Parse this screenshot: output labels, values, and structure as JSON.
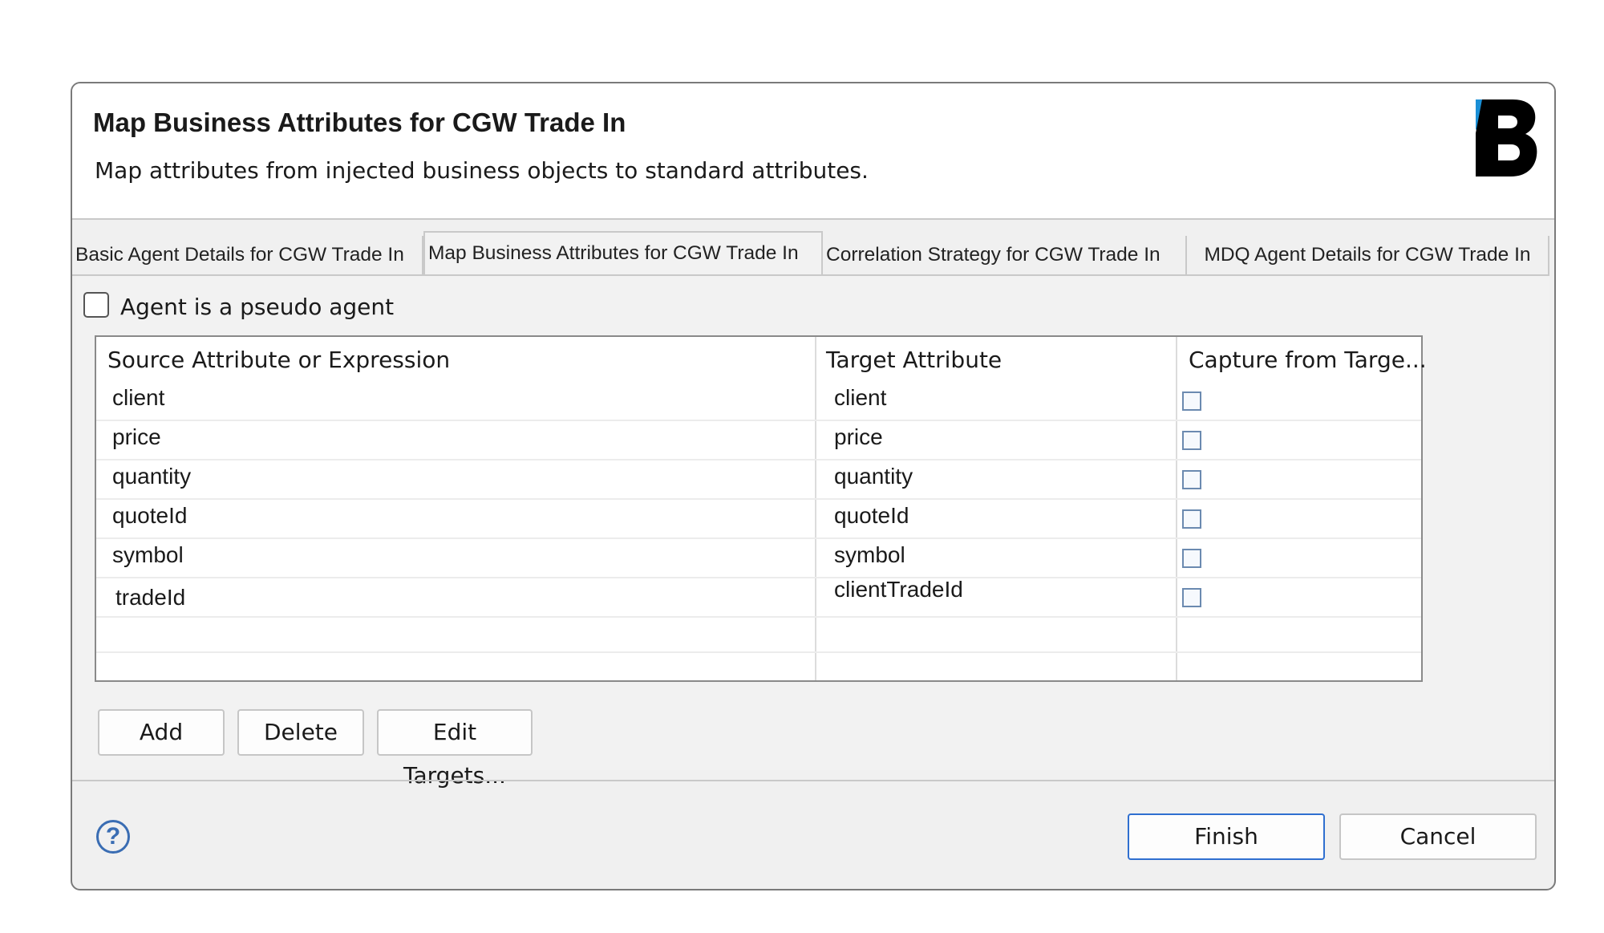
{
  "dialog": {
    "title": "Map Business Attributes for CGW Trade In",
    "subtitle": "Map attributes from injected business objects to standard attributes.",
    "logo_icon": "brand-b-logo"
  },
  "tabs": [
    {
      "label": "Basic Agent Details for CGW Trade In",
      "active": false
    },
    {
      "label": "Map Business Attributes for CGW Trade In",
      "active": true
    },
    {
      "label": "Correlation Strategy for CGW Trade In",
      "active": false
    },
    {
      "label": "MDQ Agent Details for CGW Trade In",
      "active": false
    }
  ],
  "pseudo_agent": {
    "label": "Agent is a pseudo agent",
    "checked": false
  },
  "table": {
    "headers": [
      "Source Attribute or Expression",
      "Target Attribute",
      "Capture from Targe..."
    ],
    "rows": [
      {
        "source": "client",
        "target": "client",
        "capture": false
      },
      {
        "source": "price",
        "target": "price",
        "capture": false
      },
      {
        "source": "quantity",
        "target": "quantity",
        "capture": false
      },
      {
        "source": "quoteId",
        "target": "quoteId",
        "capture": false
      },
      {
        "source": "symbol",
        "target": "symbol",
        "capture": false
      },
      {
        "source": "tradeId",
        "target": "clientTradeId",
        "capture": false
      }
    ]
  },
  "buttons": {
    "add": "Add",
    "delete": "Delete",
    "edit_targets": "Edit Targets...",
    "finish": "Finish",
    "cancel": "Cancel"
  },
  "help_glyph": "?",
  "colors": {
    "accent": "#2f6fd0",
    "help": "#3a6db3",
    "logo_blue": "#1a8fd6"
  }
}
